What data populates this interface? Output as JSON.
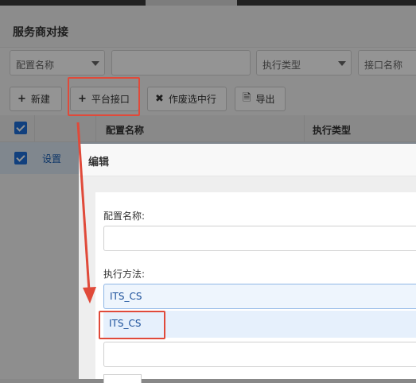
{
  "page": {
    "title": "服务商对接"
  },
  "filters": {
    "config_name": {
      "placeholder": "配置名称",
      "value": ""
    },
    "text_input": {
      "value": ""
    },
    "exec_type": {
      "placeholder": "执行类型"
    },
    "interface_name": {
      "placeholder": "接口名称"
    }
  },
  "toolbar": {
    "new_label": "新建",
    "platform_interface_label": "平台接口",
    "void_selected_label": "作废选中行",
    "export_label": "导出"
  },
  "table": {
    "headers": [
      "配置名称",
      "执行类型"
    ],
    "rows": [
      {
        "checked": true,
        "action_link": "设置"
      }
    ]
  },
  "modal": {
    "title": "编辑",
    "config_name_label": "配置名称:",
    "config_name_value": "",
    "exec_method_label": "执行方法:",
    "exec_method_value": "ITS_CS",
    "dropdown_options": [
      "ITS_CS"
    ]
  },
  "colors": {
    "accent_blue": "#1e6fd9",
    "annotation_red": "#e04a3a",
    "selected_bg": "#eef5fd"
  }
}
